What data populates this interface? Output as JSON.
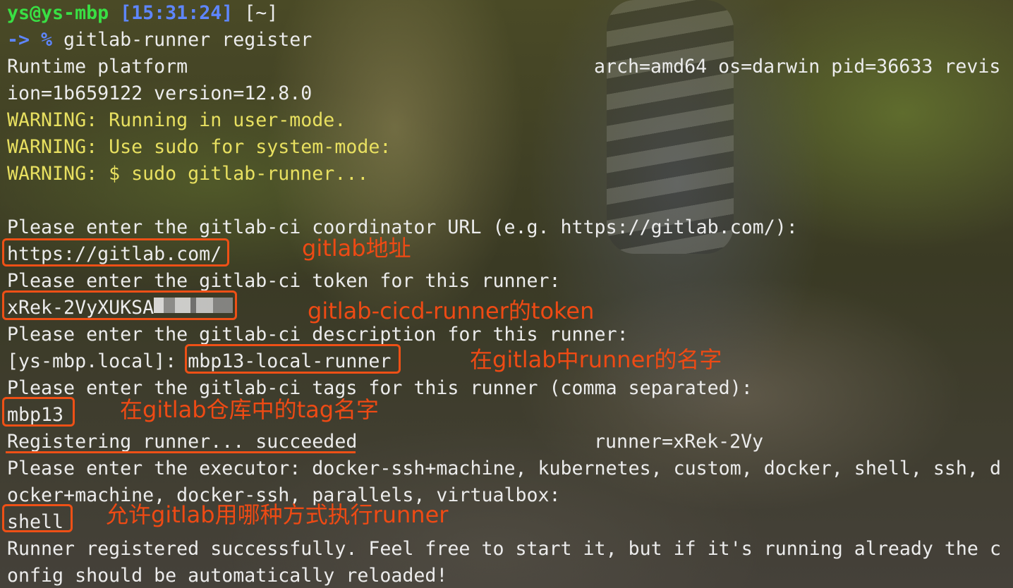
{
  "prompt": {
    "user_host": "ys@ys-mbp",
    "time": "[15:31:24]",
    "dir": "[~]",
    "arrow": "-> %",
    "command": " gitlab-runner register"
  },
  "lines": {
    "runtime_left": "Runtime platform",
    "runtime_right": "arch=amd64 os=darwin pid=36633 revis",
    "runtime_cont": "ion=1b659122 version=12.8.0",
    "warn1": "WARNING: Running in user-mode.",
    "warn2": "WARNING: Use sudo for system-mode:",
    "warn3": "WARNING: $ sudo gitlab-runner...",
    "url_prompt": "Please enter the gitlab-ci coordinator URL (e.g. https://gitlab.com/):",
    "url_value": "https://gitlab.com/",
    "token_prompt": "Please enter the gitlab-ci token for this runner:",
    "token_value": "xRek-2VyXUKSA",
    "desc_prompt": "Please enter the gitlab-ci description for this runner:",
    "desc_default": "[ys-mbp.local]: ",
    "desc_value": "mbp13-local-runner",
    "tags_prompt": "Please enter the gitlab-ci tags for this runner (comma separated):",
    "tags_value": "mbp13",
    "registering_left": "Registering runner... succeeded",
    "registering_right": "runner=xRek-2Vy",
    "executor_prompt_1": "Please enter the executor: docker-ssh+machine, kubernetes, custom, docker, shell, ssh, d",
    "executor_prompt_2": "ocker+machine, docker-ssh, parallels, virtualbox:",
    "executor_value": "shell",
    "success_1": "Runner registered successfully. Feel free to start it, but if it's running already the c",
    "success_2": "onfig should be automatically reloaded!"
  },
  "annotations": {
    "url": "gitlab地址",
    "token": "gitlab-cicd-runner的token",
    "description": "在gitlab中runner的名字",
    "tags": "在gitlab仓库中的tag名字",
    "executor": "允许gitlab用哪种方式执行runner"
  },
  "colors": {
    "prompt_user": "#39e044",
    "prompt_time": "#5e86ff",
    "warning": "#e8e060",
    "text": "#ececec",
    "annotation": "#ee4a14"
  }
}
